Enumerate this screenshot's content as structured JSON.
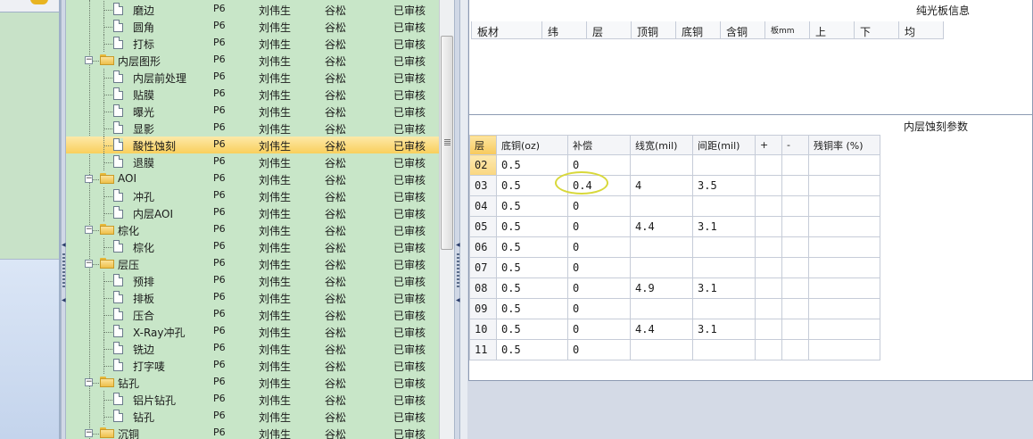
{
  "tree": {
    "rows": [
      {
        "label": "磨边",
        "type": "item",
        "level": 2,
        "code": "P6",
        "user1": "刘伟生",
        "user2": "谷松",
        "status": "已审核"
      },
      {
        "label": "圆角",
        "type": "item",
        "level": 2,
        "code": "P6",
        "user1": "刘伟生",
        "user2": "谷松",
        "status": "已审核"
      },
      {
        "label": "打标",
        "type": "item",
        "level": 2,
        "code": "P6",
        "user1": "刘伟生",
        "user2": "谷松",
        "status": "已审核"
      },
      {
        "label": "内层图形",
        "type": "folder",
        "level": 1,
        "code": "P6",
        "user1": "刘伟生",
        "user2": "谷松",
        "status": "已审核"
      },
      {
        "label": "内层前处理",
        "type": "item",
        "level": 2,
        "code": "P6",
        "user1": "刘伟生",
        "user2": "谷松",
        "status": "已审核"
      },
      {
        "label": "贴膜",
        "type": "item",
        "level": 2,
        "code": "P6",
        "user1": "刘伟生",
        "user2": "谷松",
        "status": "已审核"
      },
      {
        "label": "曝光",
        "type": "item",
        "level": 2,
        "code": "P6",
        "user1": "刘伟生",
        "user2": "谷松",
        "status": "已审核"
      },
      {
        "label": "显影",
        "type": "item",
        "level": 2,
        "code": "P6",
        "user1": "刘伟生",
        "user2": "谷松",
        "status": "已审核"
      },
      {
        "label": "酸性蚀刻",
        "type": "item",
        "level": 2,
        "code": "P6",
        "user1": "刘伟生",
        "user2": "谷松",
        "status": "已审核",
        "selected": true
      },
      {
        "label": "退膜",
        "type": "item",
        "level": 2,
        "code": "P6",
        "user1": "刘伟生",
        "user2": "谷松",
        "status": "已审核"
      },
      {
        "label": "AOI",
        "type": "folder",
        "level": 1,
        "code": "P6",
        "user1": "刘伟生",
        "user2": "谷松",
        "status": "已审核"
      },
      {
        "label": "冲孔",
        "type": "item",
        "level": 2,
        "code": "P6",
        "user1": "刘伟生",
        "user2": "谷松",
        "status": "已审核"
      },
      {
        "label": "内层AOI",
        "type": "item",
        "level": 2,
        "code": "P6",
        "user1": "刘伟生",
        "user2": "谷松",
        "status": "已审核"
      },
      {
        "label": "棕化",
        "type": "folder",
        "level": 1,
        "code": "P6",
        "user1": "刘伟生",
        "user2": "谷松",
        "status": "已审核"
      },
      {
        "label": "棕化",
        "type": "item",
        "level": 2,
        "code": "P6",
        "user1": "刘伟生",
        "user2": "谷松",
        "status": "已审核"
      },
      {
        "label": "层压",
        "type": "folder",
        "level": 1,
        "code": "P6",
        "user1": "刘伟生",
        "user2": "谷松",
        "status": "已审核"
      },
      {
        "label": "预排",
        "type": "item",
        "level": 2,
        "code": "P6",
        "user1": "刘伟生",
        "user2": "谷松",
        "status": "已审核"
      },
      {
        "label": "排板",
        "type": "item",
        "level": 2,
        "code": "P6",
        "user1": "刘伟生",
        "user2": "谷松",
        "status": "已审核"
      },
      {
        "label": "压合",
        "type": "item",
        "level": 2,
        "code": "P6",
        "user1": "刘伟生",
        "user2": "谷松",
        "status": "已审核"
      },
      {
        "label": "X-Ray冲孔",
        "type": "item",
        "level": 2,
        "code": "P6",
        "user1": "刘伟生",
        "user2": "谷松",
        "status": "已审核"
      },
      {
        "label": "铣边",
        "type": "item",
        "level": 2,
        "code": "P6",
        "user1": "刘伟生",
        "user2": "谷松",
        "status": "已审核"
      },
      {
        "label": "打字唛",
        "type": "item",
        "level": 2,
        "code": "P6",
        "user1": "刘伟生",
        "user2": "谷松",
        "status": "已审核"
      },
      {
        "label": "钻孔",
        "type": "folder",
        "level": 1,
        "code": "P6",
        "user1": "刘伟生",
        "user2": "谷松",
        "status": "已审核"
      },
      {
        "label": "铝片钻孔",
        "type": "item",
        "level": 2,
        "code": "P6",
        "user1": "刘伟生",
        "user2": "谷松",
        "status": "已审核"
      },
      {
        "label": "钻孔",
        "type": "item",
        "level": 2,
        "code": "P6",
        "user1": "刘伟生",
        "user2": "谷松",
        "status": "已审核"
      },
      {
        "label": "沉铜",
        "type": "folder",
        "level": 1,
        "code": "P6",
        "user1": "刘伟生",
        "user2": "谷松",
        "status": "已审核"
      }
    ]
  },
  "board_info": {
    "title": "纯光板信息",
    "columns": [
      "板材",
      "纬",
      "层",
      "顶铜",
      "底铜",
      "含铜",
      "板mm",
      "上",
      "下",
      "均"
    ]
  },
  "etch_params": {
    "title": "内层蚀刻参数",
    "columns": [
      "层",
      "底铜(oz)",
      "补偿",
      "线宽(mil)",
      "间距(mil)",
      "+",
      "-",
      "残铜率 (%)"
    ],
    "rows": [
      [
        "02",
        "0.5",
        "0",
        "",
        "",
        "",
        "",
        ""
      ],
      [
        "03",
        "0.5",
        "0.4",
        "4",
        "3.5",
        "",
        "",
        ""
      ],
      [
        "04",
        "0.5",
        "0",
        "",
        "",
        "",
        "",
        ""
      ],
      [
        "05",
        "0.5",
        "0",
        "4.4",
        "3.1",
        "",
        "",
        ""
      ],
      [
        "06",
        "0.5",
        "0",
        "",
        "",
        "",
        "",
        ""
      ],
      [
        "07",
        "0.5",
        "0",
        "",
        "",
        "",
        "",
        ""
      ],
      [
        "08",
        "0.5",
        "0",
        "4.9",
        "3.1",
        "",
        "",
        ""
      ],
      [
        "09",
        "0.5",
        "0",
        "",
        "",
        "",
        "",
        ""
      ],
      [
        "10",
        "0.5",
        "0",
        "4.4",
        "3.1",
        "",
        "",
        ""
      ],
      [
        "11",
        "0.5",
        "0",
        "",
        "",
        "",
        "",
        ""
      ]
    ],
    "current_row": 0
  },
  "colors": {
    "tree_bg": "#c8e6c8",
    "selection": "#f9cf5c",
    "highlight_ring": "#d8d83a"
  }
}
